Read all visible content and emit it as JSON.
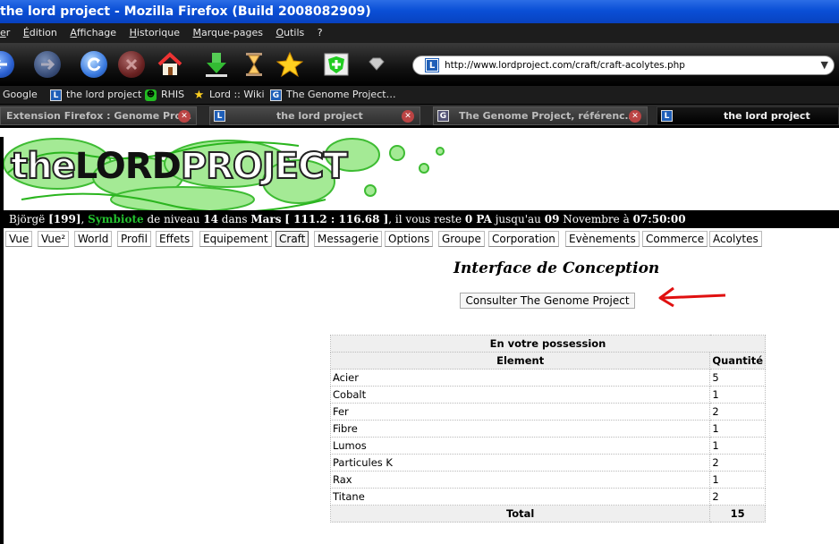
{
  "window": {
    "title": "the lord project - Mozilla Firefox (Build 2008082909)"
  },
  "menubar": [
    "er",
    "Édition",
    "Affichage",
    "Historique",
    "Marque-pages",
    "Outils",
    "?"
  ],
  "toolbar": {
    "url": "http://www.lordproject.com/craft/craft-acolytes.php",
    "icons": [
      "back-icon",
      "forward-icon",
      "reload-icon",
      "stop-icon",
      "home-icon",
      "download-icon",
      "hourglass-icon",
      "star-icon",
      "shield-icon",
      "gem-icon"
    ]
  },
  "bookmarks": [
    {
      "label": "Google",
      "icon": ""
    },
    {
      "label": "the lord project",
      "icon": "L"
    },
    {
      "label": "RHIS",
      "icon": "frog-icon"
    },
    {
      "label": "Lord :: Wiki",
      "icon": "star-icon"
    },
    {
      "label": "The Genome Project…",
      "icon": "G"
    }
  ],
  "tabs": [
    {
      "label": "Extension Firefox : Genome Pro…",
      "icon": ""
    },
    {
      "label": "the lord project",
      "icon": "L"
    },
    {
      "label": "The Genome Project, référenc…",
      "icon": "G"
    },
    {
      "label": "the lord project",
      "icon": "L",
      "active": true
    }
  ],
  "site": {
    "logo": {
      "part1": "the",
      "part2": "LORD",
      "part3": "PROJECT"
    },
    "status": {
      "name": "Björgë",
      "level_bracket": "[199]",
      "race": "Symbiote",
      "de_niveau": "de niveau",
      "level": "14",
      "dans": "dans",
      "planet": "Mars",
      "coords": "[ 111.2 : 116.68 ]",
      "il_vous_reste": ", il vous reste",
      "pa": "0 PA",
      "jusquau": "jusqu'au",
      "date_day": "09",
      "date_month": "Novembre",
      "a": "à",
      "time": "07:50:00"
    },
    "menu": [
      "Vue",
      "Vue²",
      "World",
      "Profil",
      "Effets",
      "Equipement",
      "Craft",
      "Messagerie",
      "Options",
      "Groupe",
      "Corporation",
      "Evènements",
      "Commerce",
      "Acolytes"
    ],
    "active_menu": "Craft"
  },
  "main": {
    "title": "Interface de Conception",
    "genome_button": "Consulter The Genome Project",
    "inventory": {
      "caption": "En votre possession",
      "col_element": "Element",
      "col_qty": "Quantité",
      "rows": [
        {
          "element": "Acier",
          "qty": "5"
        },
        {
          "element": "Cobalt",
          "qty": "1"
        },
        {
          "element": "Fer",
          "qty": "2"
        },
        {
          "element": "Fibre",
          "qty": "1"
        },
        {
          "element": "Lumos",
          "qty": "1"
        },
        {
          "element": "Particules K",
          "qty": "2"
        },
        {
          "element": "Rax",
          "qty": "1"
        },
        {
          "element": "Titane",
          "qty": "2"
        }
      ],
      "total_label": "Total",
      "total_value": "15"
    }
  },
  "colors": {
    "accent_green": "#23c02e",
    "arrow_red": "#e01010",
    "titlebar_blue": "#0a4fd6"
  }
}
